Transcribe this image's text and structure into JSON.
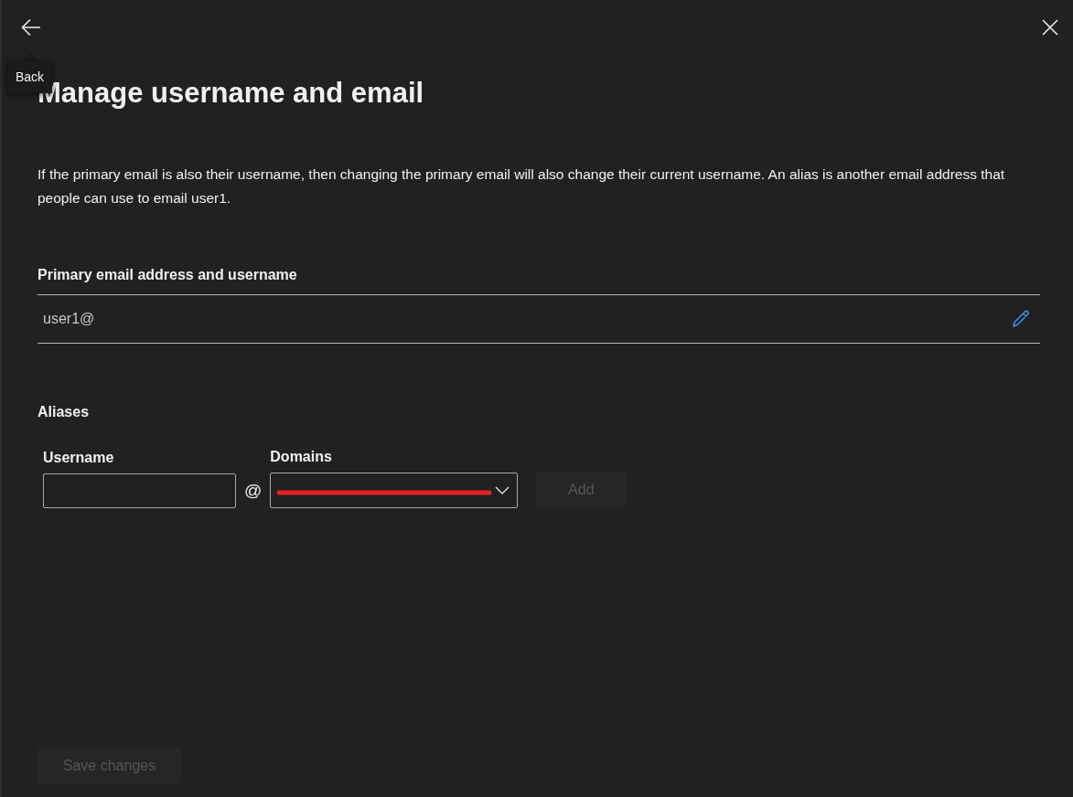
{
  "back_tooltip": "Back",
  "title": "Manage username and email",
  "description": "If the primary email is also their username, then changing the primary email will also change their current username. An alias is another email address that people can use to email user1.",
  "primary": {
    "label": "Primary email address and username",
    "value": "user1@"
  },
  "aliases": {
    "heading": "Aliases",
    "username_label": "Username",
    "at": "@",
    "domains_label": "Domains",
    "add_button": {
      "label": "Add",
      "disabled": true
    }
  },
  "save_button": {
    "label": "Save changes",
    "disabled": true
  }
}
